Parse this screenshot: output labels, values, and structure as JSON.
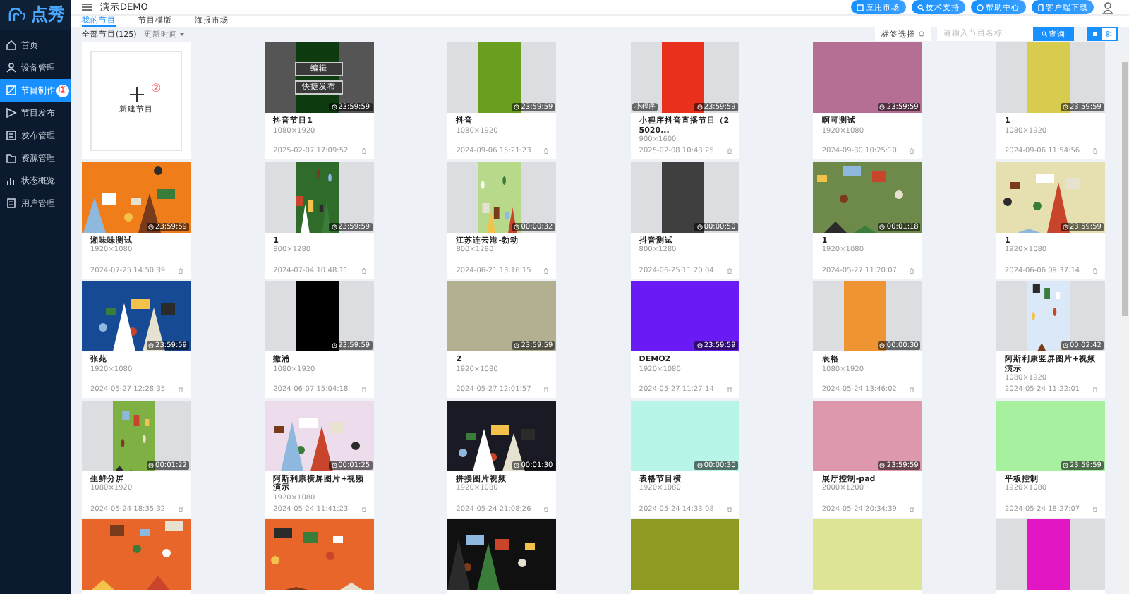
{
  "logo": {
    "text": "点秀"
  },
  "sidebar": {
    "items": [
      {
        "label": "首页",
        "selected": false
      },
      {
        "label": "设备管理",
        "selected": false
      },
      {
        "label": "节目制作",
        "selected": true,
        "badge": "①"
      },
      {
        "label": "节目发布",
        "selected": false
      },
      {
        "label": "发布管理",
        "selected": false
      },
      {
        "label": "资源管理",
        "selected": false
      },
      {
        "label": "状态概览",
        "selected": false
      },
      {
        "label": "用户管理",
        "selected": false
      }
    ]
  },
  "topbar": {
    "title": "演示DEMO",
    "buttons": [
      "应用市场",
      "技术支持",
      "帮助中心",
      "客户端下载"
    ]
  },
  "tabs": [
    {
      "label": "我的节目",
      "selected": true
    },
    {
      "label": "节目模版",
      "selected": false
    },
    {
      "label": "海报市场",
      "selected": false
    }
  ],
  "filters": {
    "count_label": "全部节目(125)",
    "sort": "更新时间"
  },
  "search": {
    "tag_select": "标签选择",
    "placeholder": "请输入节目名称",
    "button": "查询"
  },
  "view_modes": [
    {
      "kind": "grid",
      "selected": true
    },
    {
      "kind": "list",
      "selected": false
    }
  ],
  "new_card": {
    "label": "新建节目",
    "badge": "②"
  },
  "programs": [
    {
      "title": "抖音节目1",
      "size": "1080×1920",
      "date": "2025-02-07 17:09:52",
      "duration": "23:59:59",
      "thumb": {
        "kind": "portrait",
        "color": "#0e3a10"
      },
      "hover_actions": [
        "编辑",
        "快捷发布"
      ]
    },
    {
      "title": "抖音",
      "size": "1080×1920",
      "date": "2024-09-06 15:21:23",
      "duration": "23:59:59",
      "thumb": {
        "kind": "portrait",
        "color": "#6a9e1f"
      }
    },
    {
      "title": "小程序抖音直播节目（25020...",
      "size": "900×1600",
      "date": "2025-02-08 10:43:25",
      "duration": "23:59:59",
      "tag": "小程序",
      "thumb": {
        "kind": "portrait",
        "color": "#e8301c"
      }
    },
    {
      "title": "啊可测试",
      "size": "1920×1080",
      "date": "2024-09-30 10:25:10",
      "duration": "23:59:59",
      "thumb": {
        "kind": "landscape",
        "color": "#b56e94"
      }
    },
    {
      "title": "1",
      "size": "1080×1920",
      "date": "2024-09-06 11:54:56",
      "duration": "23:59:59",
      "thumb": {
        "kind": "portrait",
        "color": "#d8cc4e"
      }
    },
    {
      "title": "湘味味测试",
      "size": "1920×1080",
      "date": "2024-07-25 14:50:39",
      "duration": "23:59:59",
      "thumb": {
        "kind": "picture",
        "color": "#ef7d1a"
      }
    },
    {
      "title": "1",
      "size": "800×1280",
      "date": "2024-07-04 10:48:11",
      "duration": "23:59:59",
      "thumb": {
        "kind": "portrait-picture",
        "color": "#2f6b2a"
      }
    },
    {
      "title": "江苏连云港-勃动",
      "size": "800×1280",
      "date": "2024-06-21 13:16:15",
      "duration": "00:00:32",
      "thumb": {
        "kind": "portrait-picture",
        "color": "#b8d98a"
      }
    },
    {
      "title": "抖音测试",
      "size": "800×1280",
      "date": "2024-06-25 11:20:04",
      "duration": "00:00:50",
      "thumb": {
        "kind": "portrait",
        "color": "#3f3f3f"
      }
    },
    {
      "title": "1",
      "size": "1920×1080",
      "date": "2024-05-27 11:20:07",
      "duration": "00:01:18",
      "thumb": {
        "kind": "picture",
        "color": "#6d8a4a"
      }
    },
    {
      "title": "1",
      "size": "1920×1080",
      "date": "2024-06-06 09:37:14",
      "duration": "23:59:59",
      "thumb": {
        "kind": "picture",
        "color": "#e6dfb0"
      }
    },
    {
      "title": "张苑",
      "size": "1920×1080",
      "date": "2024-05-27 12:28:35",
      "duration": "23:59:59",
      "thumb": {
        "kind": "picture",
        "color": "#174a94"
      }
    },
    {
      "title": "撒浦",
      "size": "1080×1920",
      "date": "2024-06-07 15:04:18",
      "duration": "23:59:59",
      "thumb": {
        "kind": "portrait",
        "color": "#000000"
      }
    },
    {
      "title": "2",
      "size": "1920×1080",
      "date": "2024-05-27 12:01:57",
      "duration": "23:59:59",
      "thumb": {
        "kind": "landscape",
        "color": "#b2b091"
      }
    },
    {
      "title": "DEMO2",
      "size": "1920×1080",
      "date": "2024-05-27 11:27:14",
      "duration": "23:59:59",
      "thumb": {
        "kind": "landscape",
        "color": "#6a1bf5"
      }
    },
    {
      "title": "表格",
      "size": "1080×1920",
      "date": "2024-05-24 13:46:02",
      "duration": "00:00:30",
      "thumb": {
        "kind": "portrait",
        "color": "#ef9432"
      }
    },
    {
      "title": "阿斯利康竖屏图片+视频演示",
      "size": "1080×1920",
      "date": "2024-05-24 11:22:01",
      "duration": "00:02:42",
      "thumb": {
        "kind": "portrait-picture",
        "color": "#dbe8f7"
      }
    },
    {
      "title": "生鲜分屏",
      "size": "1080×1920",
      "date": "2024-05-24 18:35:32",
      "duration": "00:01:22",
      "thumb": {
        "kind": "portrait-picture",
        "color": "#7fb043"
      }
    },
    {
      "title": "阿斯利康横屏图片+视频演示",
      "size": "1920×1080",
      "date": "2024-05-24 11:41:23",
      "duration": "00:01:25",
      "thumb": {
        "kind": "picture",
        "color": "#ecdcec"
      }
    },
    {
      "title": "拼接图片视频",
      "size": "1920×1080",
      "date": "2024-05-24 21:08:26",
      "duration": "00:01:30",
      "thumb": {
        "kind": "picture",
        "color": "#1a1a24"
      }
    },
    {
      "title": "表格节目横",
      "size": "1920×1080",
      "date": "2024-05-24 14:33:08",
      "duration": "00:00:30",
      "thumb": {
        "kind": "landscape",
        "color": "#b6f5e8"
      }
    },
    {
      "title": "展厅控制-pad",
      "size": "2000×1200",
      "date": "2024-05-24 20:34:39",
      "duration": "23:59:59",
      "thumb": {
        "kind": "landscape",
        "color": "#dd98ac"
      }
    },
    {
      "title": "平板控制",
      "size": "1920×1080",
      "date": "2024-05-24 18:27:07",
      "duration": "23:59:59",
      "thumb": {
        "kind": "landscape",
        "color": "#a6f0a0"
      }
    },
    {
      "thumb": {
        "kind": "picture",
        "color": "#e8662a"
      }
    },
    {
      "thumb": {
        "kind": "picture",
        "color": "#e8662a"
      }
    },
    {
      "thumb": {
        "kind": "picture",
        "color": "#101010"
      }
    },
    {
      "thumb": {
        "kind": "landscape",
        "color": "#8f9a22"
      }
    },
    {
      "thumb": {
        "kind": "landscape",
        "color": "#dde594"
      }
    },
    {
      "thumb": {
        "kind": "portrait",
        "color": "#e316c4"
      }
    }
  ]
}
